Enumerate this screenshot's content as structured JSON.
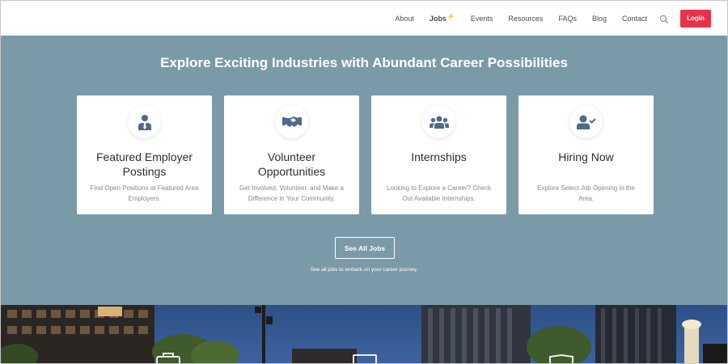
{
  "nav": {
    "items": [
      {
        "label": "About"
      },
      {
        "label": "Jobs",
        "mark": "⚡"
      },
      {
        "label": "Events"
      },
      {
        "label": "Resources"
      },
      {
        "label": "FAQs"
      },
      {
        "label": "Blog"
      },
      {
        "label": "Contact"
      }
    ],
    "search_icon": "search-icon",
    "login_label": "Login"
  },
  "band": {
    "title": "Explore Exciting Industries with Abundant Career Possibilities",
    "cards": [
      {
        "icon": "employee-icon",
        "title_line1": "Featured Employer",
        "title_line2": "Postings",
        "desc_line1": "Find Open Positions at Featured Area",
        "desc_line2": "Employers."
      },
      {
        "icon": "handshake-icon",
        "title_line1": "Volunteer",
        "title_line2": "Opportunities",
        "desc_line1": "Get Involved, Volunteer, and Make a",
        "desc_line2": "Difference in Your Community."
      },
      {
        "icon": "group-icon",
        "title_line1": "Internships",
        "title_line2": "",
        "desc_line1": "Looking to Explore a Career? Check",
        "desc_line2": "Out Available Internships."
      },
      {
        "icon": "user-check-icon",
        "title_line1": "Hiring Now",
        "title_line2": "",
        "desc_line1": "Explore Select Job Opening in the",
        "desc_line2": "Area."
      }
    ],
    "see_all_label": "See All Jobs",
    "see_all_sub": "See all jobs to embark on your career journey."
  },
  "colors": {
    "accent": "#e8324a",
    "band": "#7b9aa8",
    "icon": "#4f6a8a"
  }
}
